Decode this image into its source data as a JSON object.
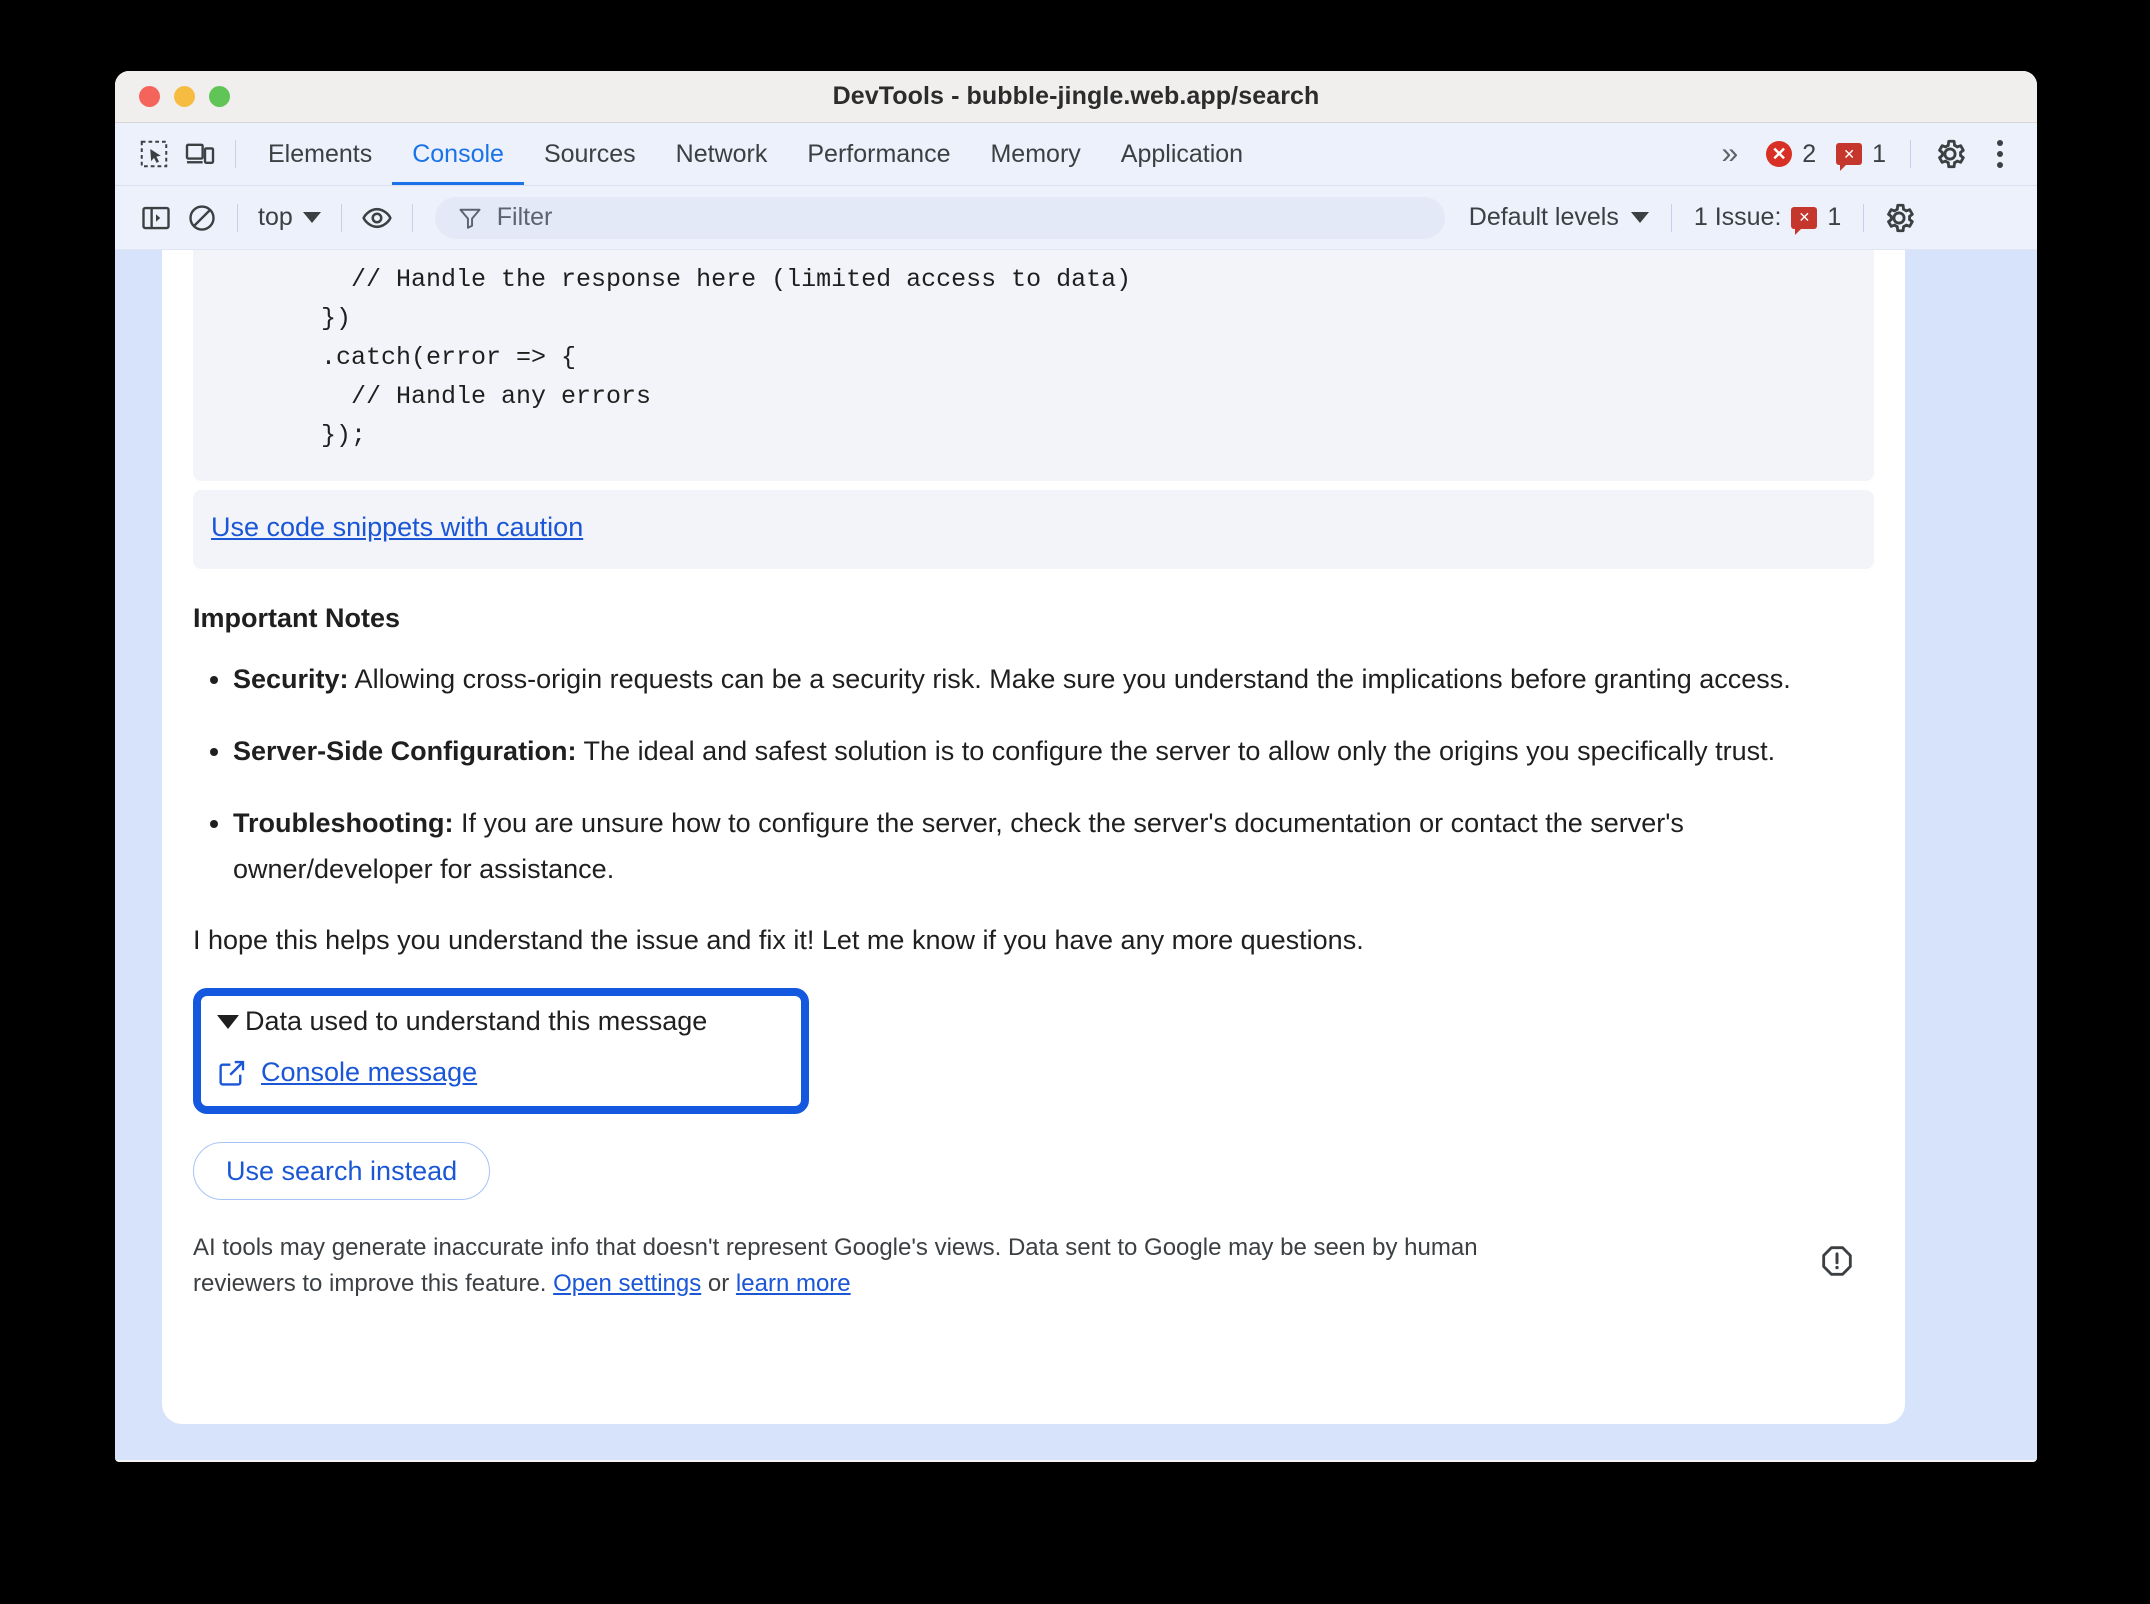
{
  "window": {
    "title": "DevTools - bubble-jingle.web.app/search",
    "traffic_lights": [
      "close-red",
      "minimize-yellow",
      "maximize-green"
    ]
  },
  "tabstrip": {
    "inspect_icon": "inspect-element-icon",
    "device_icon": "device-toolbar-icon",
    "tabs": [
      {
        "label": "Elements",
        "active": false
      },
      {
        "label": "Console",
        "active": true
      },
      {
        "label": "Sources",
        "active": false
      },
      {
        "label": "Network",
        "active": false
      },
      {
        "label": "Performance",
        "active": false
      },
      {
        "label": "Memory",
        "active": false
      },
      {
        "label": "Application",
        "active": false
      }
    ],
    "more_tabs": "»",
    "error_count": "2",
    "warning_count": "1",
    "settings_icon": "gear-icon",
    "menu_icon": "kebab-menu-icon",
    "accent_color": "#1a73e8",
    "error_color": "#d93025"
  },
  "console_toolbar": {
    "sidebar_icon": "console-sidebar-icon",
    "clear_icon": "clear-console-icon",
    "context": "top",
    "eye_icon": "live-expression-icon",
    "filter_icon": "filter-funnel-icon",
    "filter_placeholder": "Filter",
    "filter_value": "",
    "levels": "Default levels",
    "issues_label": "1 Issue:",
    "issues_count": "1",
    "settings_icon": "gear-icon"
  },
  "content": {
    "code_snippet": "    // Handle the response here (limited access to data)\n  })\n  .catch(error => {\n    // Handle any errors\n  });",
    "caution_link": "Use code snippets with caution",
    "notes_heading": "Important Notes",
    "notes": [
      {
        "term": "Security:",
        "text": " Allowing cross-origin requests can be a security risk. Make sure you understand the implications before granting access."
      },
      {
        "term": "Server-Side Configuration:",
        "text": " The ideal and safest solution is to configure the server to allow only the origins you specifically trust."
      },
      {
        "term": "Troubleshooting:",
        "text": " If you are unsure how to configure the server, check the server's documentation or contact the server's owner/developer for assistance."
      }
    ],
    "closing": "I hope this helps you understand the issue and fix it! Let me know if you have any more questions.",
    "data_box": {
      "summary": "Data used to understand this message",
      "disclosure_icon": "triangle-down-icon",
      "external_icon": "external-link-icon",
      "link_label": "Console message",
      "focus_ring_color": "#1558e0"
    },
    "use_search_button": "Use search instead",
    "disclaimer": {
      "part1": "AI tools may generate inaccurate info that doesn't represent Google's views. Data sent to Google may be seen by human reviewers to improve this feature. ",
      "link1": "Open settings",
      "mid": " or ",
      "link2": "learn more",
      "report_icon": "report-warning-icon"
    }
  }
}
